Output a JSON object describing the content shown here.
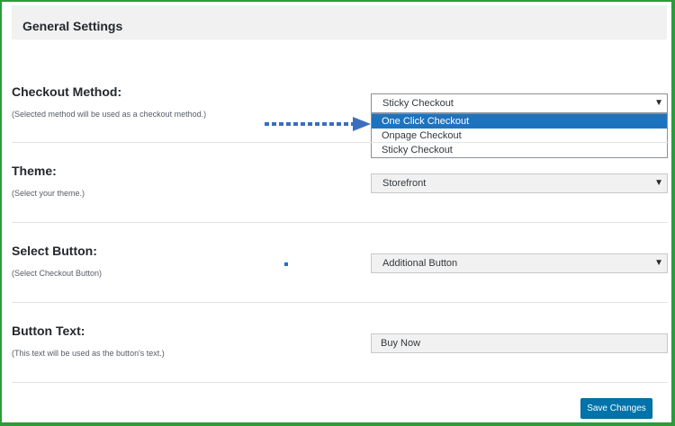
{
  "section": {
    "title": "General Settings"
  },
  "checkout": {
    "label": "Checkout Method:",
    "description": "(Selected method will be used as a checkout method.)",
    "value": "Sticky Checkout",
    "options": [
      "One Click Checkout",
      "Onpage Checkout",
      "Sticky Checkout"
    ]
  },
  "theme": {
    "label": "Theme:",
    "description": "(Select your theme.)",
    "value": "Storefront"
  },
  "select_button": {
    "label": "Select Button:",
    "description": "(Select Checkout Button)",
    "value": "Additional Button"
  },
  "button_text": {
    "label": "Button Text:",
    "description": "(This text will be used as the button's text.)",
    "value": "Buy Now"
  },
  "actions": {
    "save_label": "Save Changes"
  },
  "icons": {
    "dropdown": "chevron-down-icon",
    "annotation": "arrow-right-icon"
  },
  "colors": {
    "accent": "#0073aa",
    "highlight": "#1e73be",
    "frame": "#2a9d3a"
  }
}
